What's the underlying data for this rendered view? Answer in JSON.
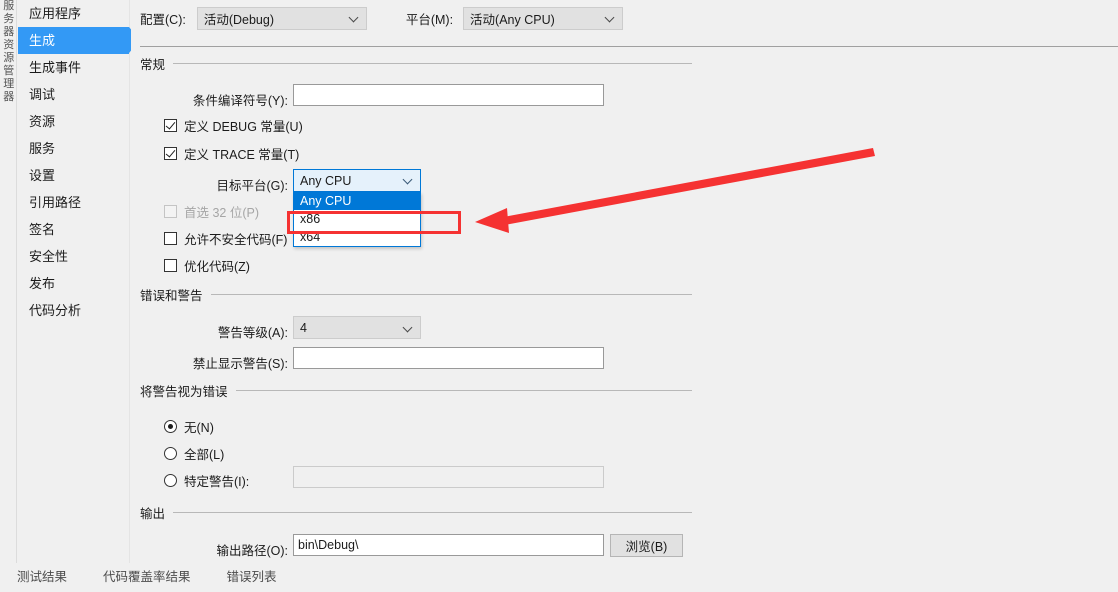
{
  "vertical_tab": {
    "label": "服务器资源管理器"
  },
  "sidebar": {
    "items": [
      {
        "label": "应用程序",
        "selected": false
      },
      {
        "label": "生成",
        "selected": true
      },
      {
        "label": "生成事件",
        "selected": false
      },
      {
        "label": "调试",
        "selected": false
      },
      {
        "label": "资源",
        "selected": false
      },
      {
        "label": "服务",
        "selected": false
      },
      {
        "label": "设置",
        "selected": false
      },
      {
        "label": "引用路径",
        "selected": false
      },
      {
        "label": "签名",
        "selected": false
      },
      {
        "label": "安全性",
        "selected": false
      },
      {
        "label": "发布",
        "selected": false
      },
      {
        "label": "代码分析",
        "selected": false
      }
    ]
  },
  "top": {
    "configuration_label": "配置(C):",
    "configuration_value": "活动(Debug)",
    "platform_label": "平台(M):",
    "platform_value": "活动(Any CPU)"
  },
  "general": {
    "group_title": "常规",
    "conditional_symbols_label": "条件编译符号(Y):",
    "conditional_symbols_value": "",
    "define_debug_label": "定义 DEBUG 常量(U)",
    "define_debug_checked": true,
    "define_trace_label": "定义 TRACE 常量(T)",
    "define_trace_checked": true,
    "target_platform_label": "目标平台(G):",
    "target_platform_value": "Any CPU",
    "target_platform_options": [
      "Any CPU",
      "x86",
      "x64"
    ],
    "target_platform_highlighted": "Any CPU",
    "prefer32_label": "首选 32 位(P)",
    "prefer32_checked": false,
    "prefer32_disabled": true,
    "allow_unsafe_label": "允许不安全代码(F)",
    "allow_unsafe_checked": false,
    "optimize_label": "优化代码(Z)",
    "optimize_checked": false
  },
  "errors_warnings": {
    "group_title": "错误和警告",
    "warning_level_label": "警告等级(A):",
    "warning_level_value": "4",
    "suppress_warnings_label": "禁止显示警告(S):",
    "suppress_warnings_value": ""
  },
  "treat_warnings": {
    "group_title": "将警告视为错误",
    "options": [
      {
        "label": "无(N)",
        "selected": true
      },
      {
        "label": "全部(L)",
        "selected": false
      },
      {
        "label": "特定警告(I):",
        "selected": false
      }
    ],
    "specific_warnings_value": ""
  },
  "output": {
    "group_title": "输出",
    "output_path_label": "输出路径(O):",
    "output_path_value": "bin\\Debug\\",
    "browse_label": "浏览(B)"
  },
  "bottom_tabs": [
    {
      "label": "测试结果"
    },
    {
      "label": "代码覆盖率结果"
    },
    {
      "label": "错误列表"
    }
  ],
  "colors": {
    "accent_blue": "#3399f5",
    "highlight_blue": "#0078d7",
    "annotation_red": "#f53232",
    "window_bg": "#f0f0f0"
  }
}
